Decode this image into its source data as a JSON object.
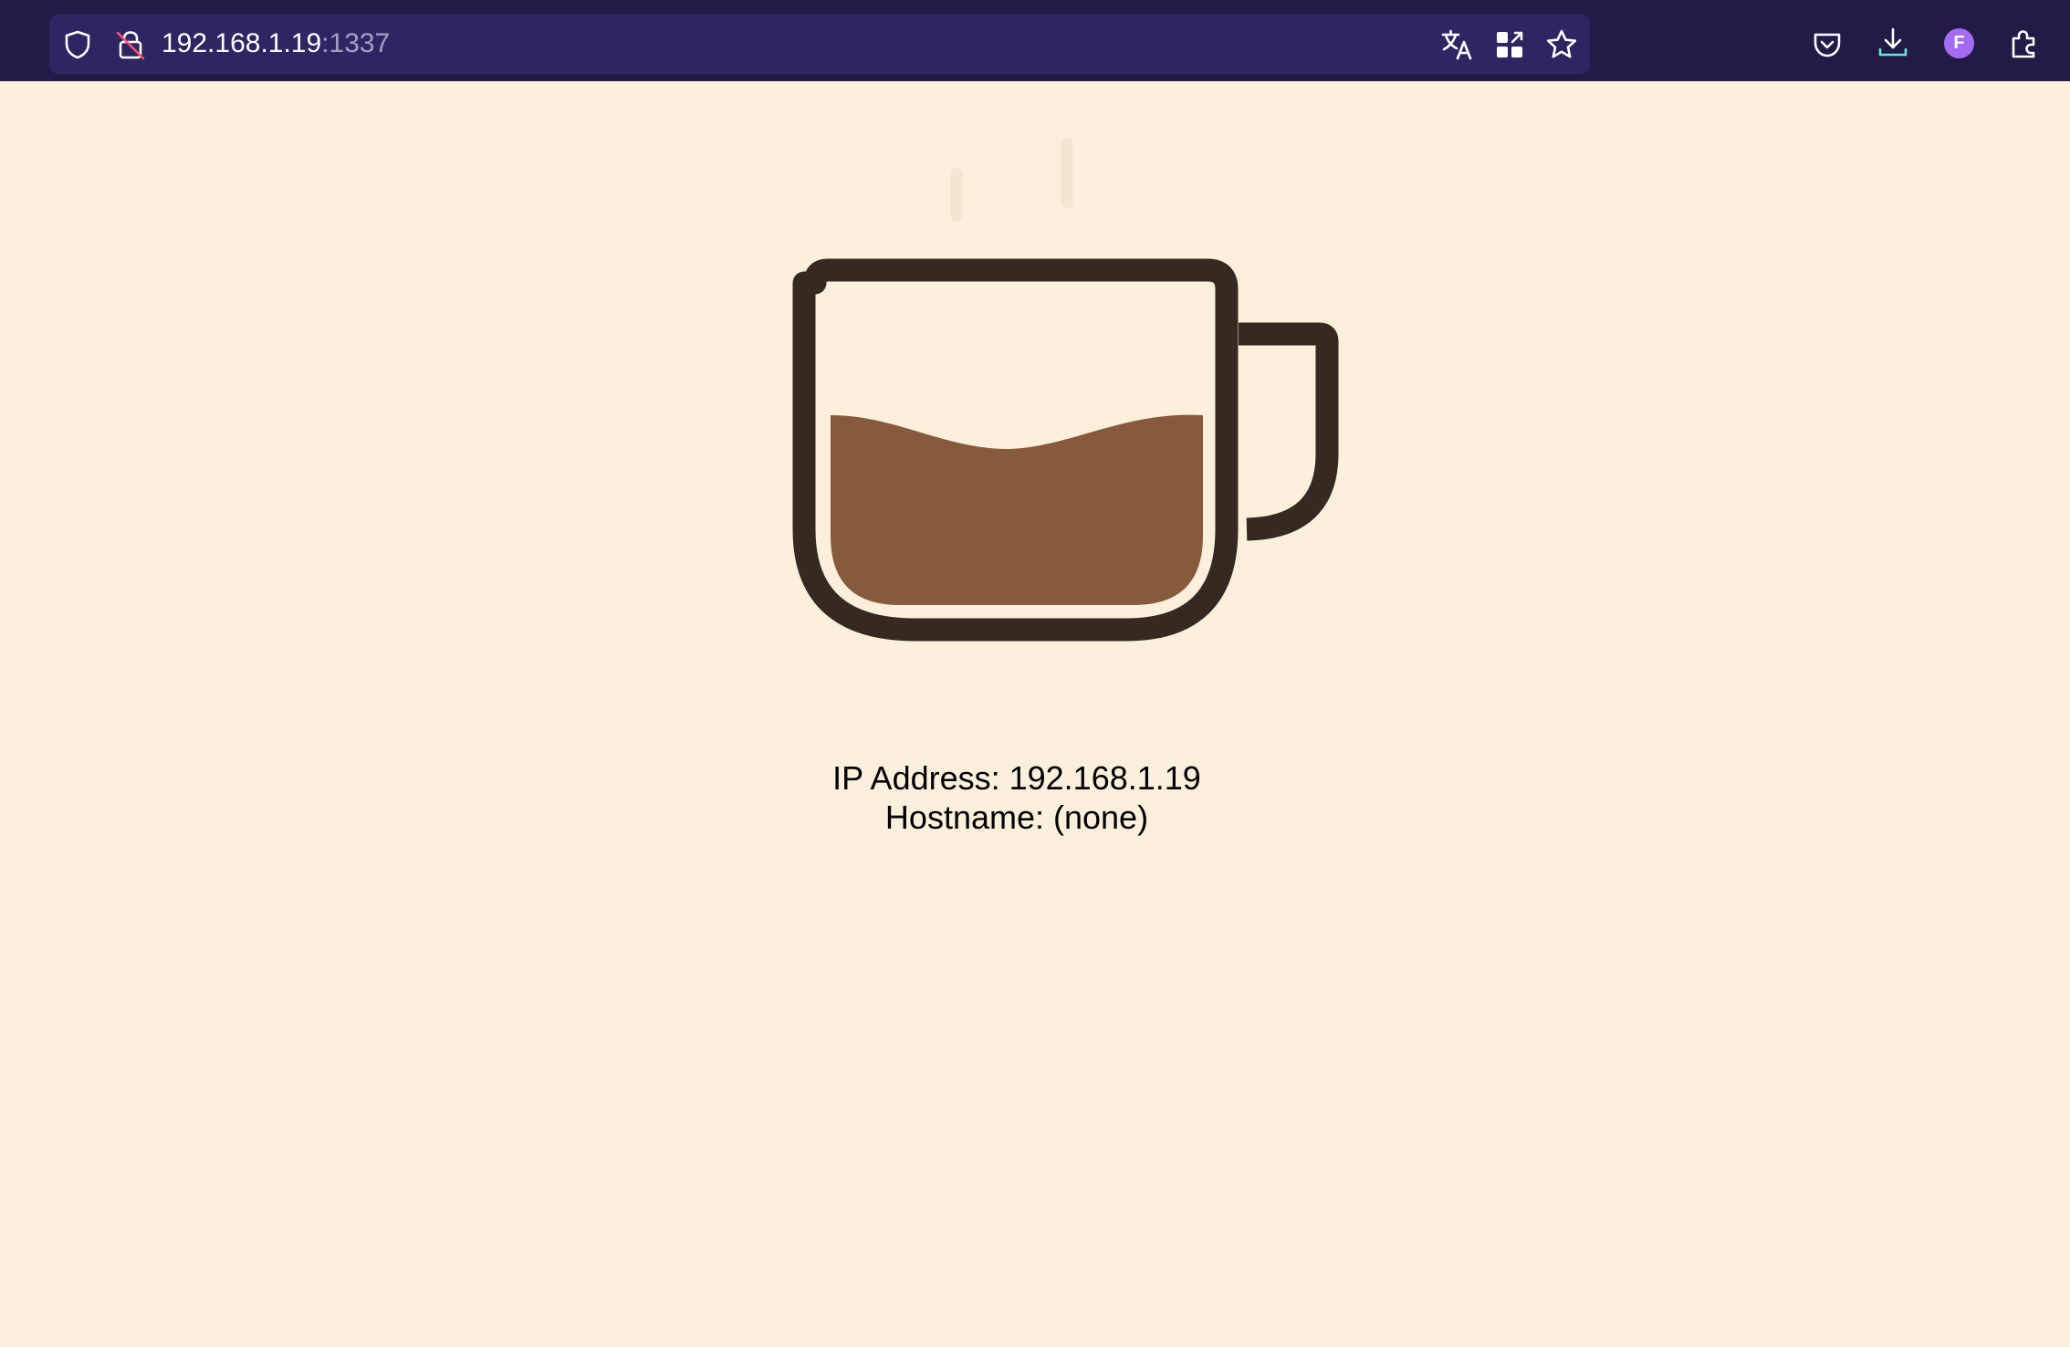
{
  "browser": {
    "url_host": "192.168.1.19",
    "url_port": ":1337",
    "profile_initial": "F",
    "icons": {
      "shield": "shield-icon",
      "insecure": "insecure-lock-icon",
      "translate": "translate-icon",
      "extensions_grid": "qr-grid-icon",
      "bookmark": "star-icon",
      "pocket": "pocket-icon",
      "downloads": "download-icon",
      "account": "account-avatar",
      "addons": "puzzle-icon"
    },
    "colors": {
      "toolbar": "#231a48",
      "urlbar": "#2f2563",
      "download_accent": "#5eead4",
      "avatar": "#a46cf2"
    }
  },
  "page": {
    "ip_label": "IP Address: 192.168.1.19",
    "hostname_label": "Hostname: (none)",
    "colors": {
      "background": "#fcefdc",
      "cup_outline": "#342a22",
      "coffee": "#875a3c",
      "steam": "#f5e5cf"
    }
  }
}
